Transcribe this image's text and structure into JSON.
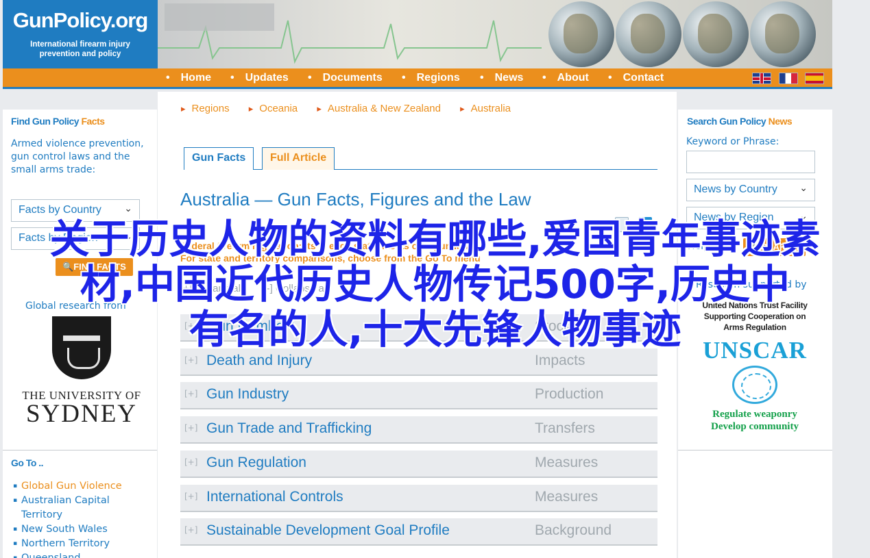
{
  "logo": {
    "title": "GunPolicy.org",
    "tagline_1": "International firearm injury",
    "tagline_2": "prevention and policy"
  },
  "nav": [
    "Home",
    "Updates",
    "Documents",
    "Regions",
    "News",
    "About",
    "Contact"
  ],
  "languages": [
    "English",
    "French",
    "Spanish"
  ],
  "left": {
    "find_title_1": "Find Gun Policy",
    "find_title_2": "Facts",
    "desc": "Armed violence prevention, gun control laws and the small arms trade:",
    "select_country": "Facts by Country",
    "select_region": "Facts by Region",
    "find_button": "FIND FACTS",
    "research_label": "Global research from",
    "sydney_the": "THE UNIVERSITY OF",
    "sydney_name": "SYDNEY",
    "goto_title": "Go To ..",
    "goto_items": [
      "Global Gun Violence",
      "Australian Capital Territory",
      "New South Wales",
      "Northern Territory",
      "Queensland"
    ]
  },
  "center": {
    "breadcrumbs": [
      "Regions",
      "Oceania",
      "Australia & New Zealand",
      "Australia"
    ],
    "tab_facts": "Gun Facts",
    "tab_article": "Full Article",
    "title": "Australia — Gun Facts, Figures and the Law",
    "fed_note_1": "Federal firearm regulation: its ... each state has its own gun law.",
    "fed_note_2": "For state and territory comparisons, choose from the Go To menu",
    "expand_all": "[+] Expand all",
    "collapse_all": "[-] Collapse all",
    "rows": [
      {
        "name": "Gun Numbers",
        "cat": "Stockpiles"
      },
      {
        "name": "Death and Injury",
        "cat": "Impacts"
      },
      {
        "name": "Gun Industry",
        "cat": "Production"
      },
      {
        "name": "Gun Trade and Trafficking",
        "cat": "Transfers"
      },
      {
        "name": "Gun Regulation",
        "cat": "Measures"
      },
      {
        "name": "International Controls",
        "cat": "Measures"
      },
      {
        "name": "Sustainable Development Goal Profile",
        "cat": "Background"
      }
    ],
    "row_plus": "[+]"
  },
  "right": {
    "search_title_1": "Search Gun Policy",
    "search_title_2": "News",
    "keyword_label": "Keyword or Phrase:",
    "select_country": "News by Country",
    "select_region": "News by Region",
    "help": "Help",
    "search_button": "SEARCH",
    "research_supported": "Research supported by",
    "unscar_trust_1": "United Nations Trust Facility",
    "unscar_trust_2": "Supporting Cooperation on",
    "unscar_trust_3": "Arms Regulation",
    "unscar_name": "UNSCAR",
    "unscar_slogan_1": "Regulate weaponry",
    "unscar_slogan_2": "Develop community"
  },
  "overlay": {
    "line_1": "关于历史人物的资料有哪些,爱国青年事迹素",
    "line_2": "材,中国近代历史人物传记500字,历史中",
    "line_3": "有名的人,十大先锋人物事迹"
  },
  "colors": {
    "brand_blue": "#1f7cc1",
    "brand_orange": "#eb8f1d",
    "overlay_blue": "#1d24e8"
  }
}
